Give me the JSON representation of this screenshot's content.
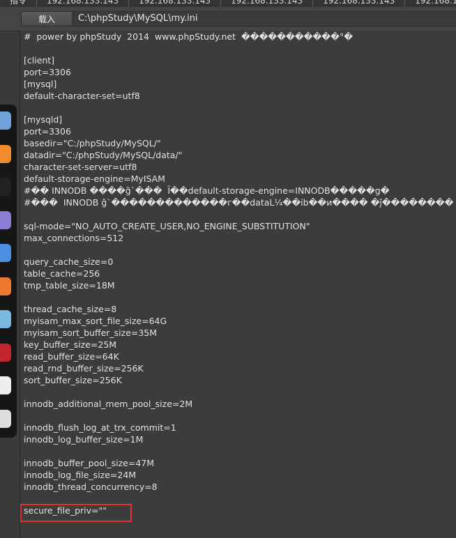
{
  "tabs": [
    "指令",
    "192.168.133.143",
    "192.168.133.143",
    "192.168.133.143",
    "192.168.133.143",
    "192.168.1"
  ],
  "toolbar": {
    "load_label": "载入",
    "path_value": "C:\\phpStudy\\MySQL\\my.ini"
  },
  "editor": {
    "lines": [
      "#  power by phpStudy  2014  www.phpStudy.net  �����������°�",
      "",
      "[client]",
      "port=3306",
      "[mysql]",
      "default-character-set=utf8",
      "",
      "[mysqld]",
      "port=3306",
      "basedir=\"C:/phpStudy/MySQL/\"",
      "datadir=\"C:/phpStudy/MySQL/data/\"",
      "character-set-server=utf8",
      "default-storage-engine=MyISAM",
      "#�� INNODB ����ĝˋ���  Ï��default-storage-engine=INNODB�����g�",
      "#���  INNODB ĝˋ�������������г��dataL¼��ib��и���� �ĵ��������",
      "",
      "sql-mode=\"NO_AUTO_CREATE_USER,NO_ENGINE_SUBSTITUTION\"",
      "max_connections=512",
      "",
      "query_cache_size=0",
      "table_cache=256",
      "tmp_table_size=18M",
      "",
      "thread_cache_size=8",
      "myisam_max_sort_file_size=64G",
      "myisam_sort_buffer_size=35M",
      "key_buffer_size=25M",
      "read_buffer_size=64K",
      "read_rnd_buffer_size=256K",
      "sort_buffer_size=256K",
      "",
      "innodb_additional_mem_pool_size=2M",
      "",
      "innodb_flush_log_at_trx_commit=1",
      "innodb_log_buffer_size=1M",
      "",
      "innodb_buffer_pool_size=47M",
      "innodb_log_file_size=24M",
      "innodb_thread_concurrency=8",
      "",
      "secure_file_priv=\"\"",
      ""
    ]
  },
  "highlight": {
    "color": "#e03030"
  },
  "dock": {
    "items": [
      {
        "icon": "finder-icon",
        "color": "#6fa3d8"
      },
      {
        "icon": "firefox-icon",
        "color": "#f08a2c"
      },
      {
        "icon": "terminal-icon",
        "color": "#222222"
      },
      {
        "icon": "notes-icon",
        "color": "#8e7fd6"
      },
      {
        "icon": "mail-icon",
        "color": "#4b8fe0"
      },
      {
        "icon": "sublime-icon",
        "color": "#f0782c"
      },
      {
        "icon": "eye-icon",
        "color": "#7ab8e0"
      },
      {
        "icon": "app-red-icon",
        "color": "#c0262c"
      },
      {
        "icon": "barcode-icon",
        "color": "#eeeeee"
      },
      {
        "icon": "launchpad-icon",
        "color": "#dddddd"
      }
    ]
  }
}
